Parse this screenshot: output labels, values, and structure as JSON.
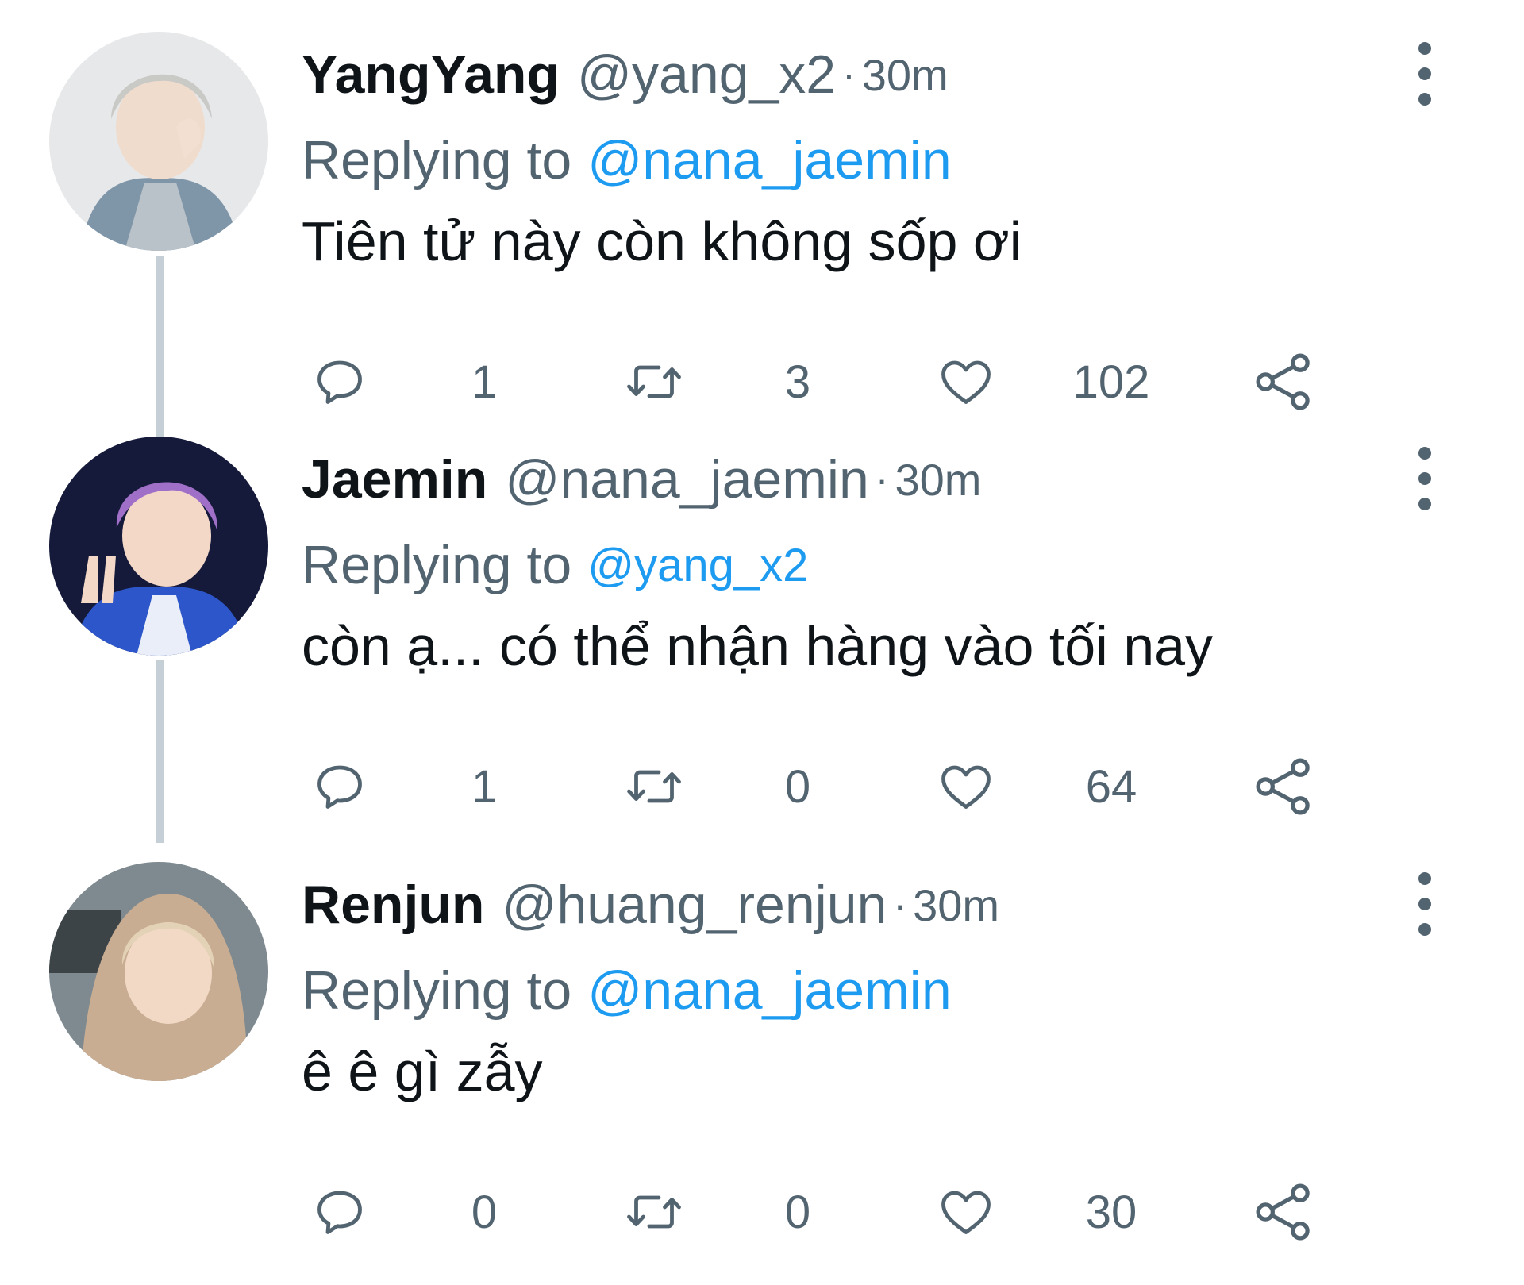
{
  "colors": {
    "text_primary": "#0f1419",
    "text_secondary": "#536471",
    "link": "#1d9bf0",
    "thread_line": "#c4cfd6"
  },
  "tweets": [
    {
      "display_name": "YangYang",
      "handle": "@yang_x2",
      "separator": "·",
      "time": "30m",
      "replying_label": "Replying to",
      "replying_to": "@nana_jaemin",
      "text": "Tiên tử này còn không sốp ơi",
      "replies": "1",
      "retweets": "3",
      "likes": "102",
      "avatar_icon": "avatar-photo-yangyang",
      "has_thread_line": true
    },
    {
      "display_name": "Jaemin",
      "handle": "@nana_jaemin",
      "separator": "·",
      "time": "30m",
      "replying_label": "Replying to",
      "replying_to": "@yang_x2",
      "text": "còn ạ... có thể nhận hàng vào tối nay",
      "replies": "1",
      "retweets": "0",
      "likes": "64",
      "avatar_icon": "avatar-photo-jaemin",
      "has_thread_line": true
    },
    {
      "display_name": "Renjun",
      "handle": "@huang_renjun",
      "separator": "·",
      "time": "30m",
      "replying_label": "Replying to",
      "replying_to": "@nana_jaemin",
      "text": "ê ê gì zẫy",
      "replies": "0",
      "retweets": "0",
      "likes": "30",
      "avatar_icon": "avatar-photo-renjun",
      "has_thread_line": false
    }
  ],
  "icons": {
    "reply": "reply-icon",
    "retweet": "retweet-icon",
    "like": "heart-icon",
    "share": "share-icon",
    "more": "more-options-icon"
  }
}
